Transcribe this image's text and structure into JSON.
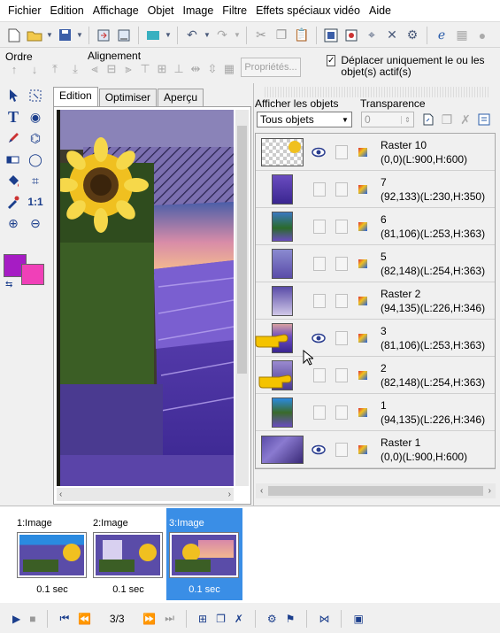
{
  "menu": [
    "Fichier",
    "Edition",
    "Affichage",
    "Objet",
    "Image",
    "Filtre",
    "Effets spéciaux vidéo",
    "Aide"
  ],
  "toolbar2": {
    "ordre_label": "Ordre",
    "alignement_label": "Alignement",
    "proprietes_label": "Propriétés...",
    "deplacer_checkbox_label": "Déplacer uniquement le ou les objet(s) actif(s)",
    "deplacer_checked": true
  },
  "tabs": [
    "Edition",
    "Optimiser",
    "Aperçu"
  ],
  "colors": {
    "foreground": "#a61cc4",
    "background": "#f040b8",
    "accent": "#3a8ee6"
  },
  "layers_panel": {
    "show_label": "Afficher les objets",
    "show_value": "Tous objets",
    "transparency_label": "Transparence",
    "transparency_value": "0"
  },
  "layers": [
    {
      "name": "Raster 10",
      "info": "(0,0)(L:900,H:600)",
      "visible": true
    },
    {
      "name": "7",
      "info": "(92,133)(L:230,H:350)",
      "visible": false
    },
    {
      "name": "6",
      "info": "(81,106)(L:253,H:363)",
      "visible": false
    },
    {
      "name": "5",
      "info": "(82,148)(L:254,H:363)",
      "visible": false
    },
    {
      "name": "Raster 2",
      "info": "(94,135)(L:226,H:346)",
      "visible": false
    },
    {
      "name": "3",
      "info": "(81,106)(L:253,H:363)",
      "visible": true
    },
    {
      "name": "2",
      "info": "(82,148)(L:254,H:363)",
      "visible": false
    },
    {
      "name": "1",
      "info": "(94,135)(L:226,H:346)",
      "visible": false
    },
    {
      "name": "Raster 1",
      "info": "(0,0)(L:900,H:600)",
      "visible": true
    }
  ],
  "frames": [
    {
      "label": "1:Image",
      "delay": "0.1 sec",
      "selected": false
    },
    {
      "label": "2:Image",
      "delay": "0.1 sec",
      "selected": false
    },
    {
      "label": "3:Image",
      "delay": "0.1 sec",
      "selected": true
    }
  ],
  "playback": {
    "counter": "3/3"
  }
}
